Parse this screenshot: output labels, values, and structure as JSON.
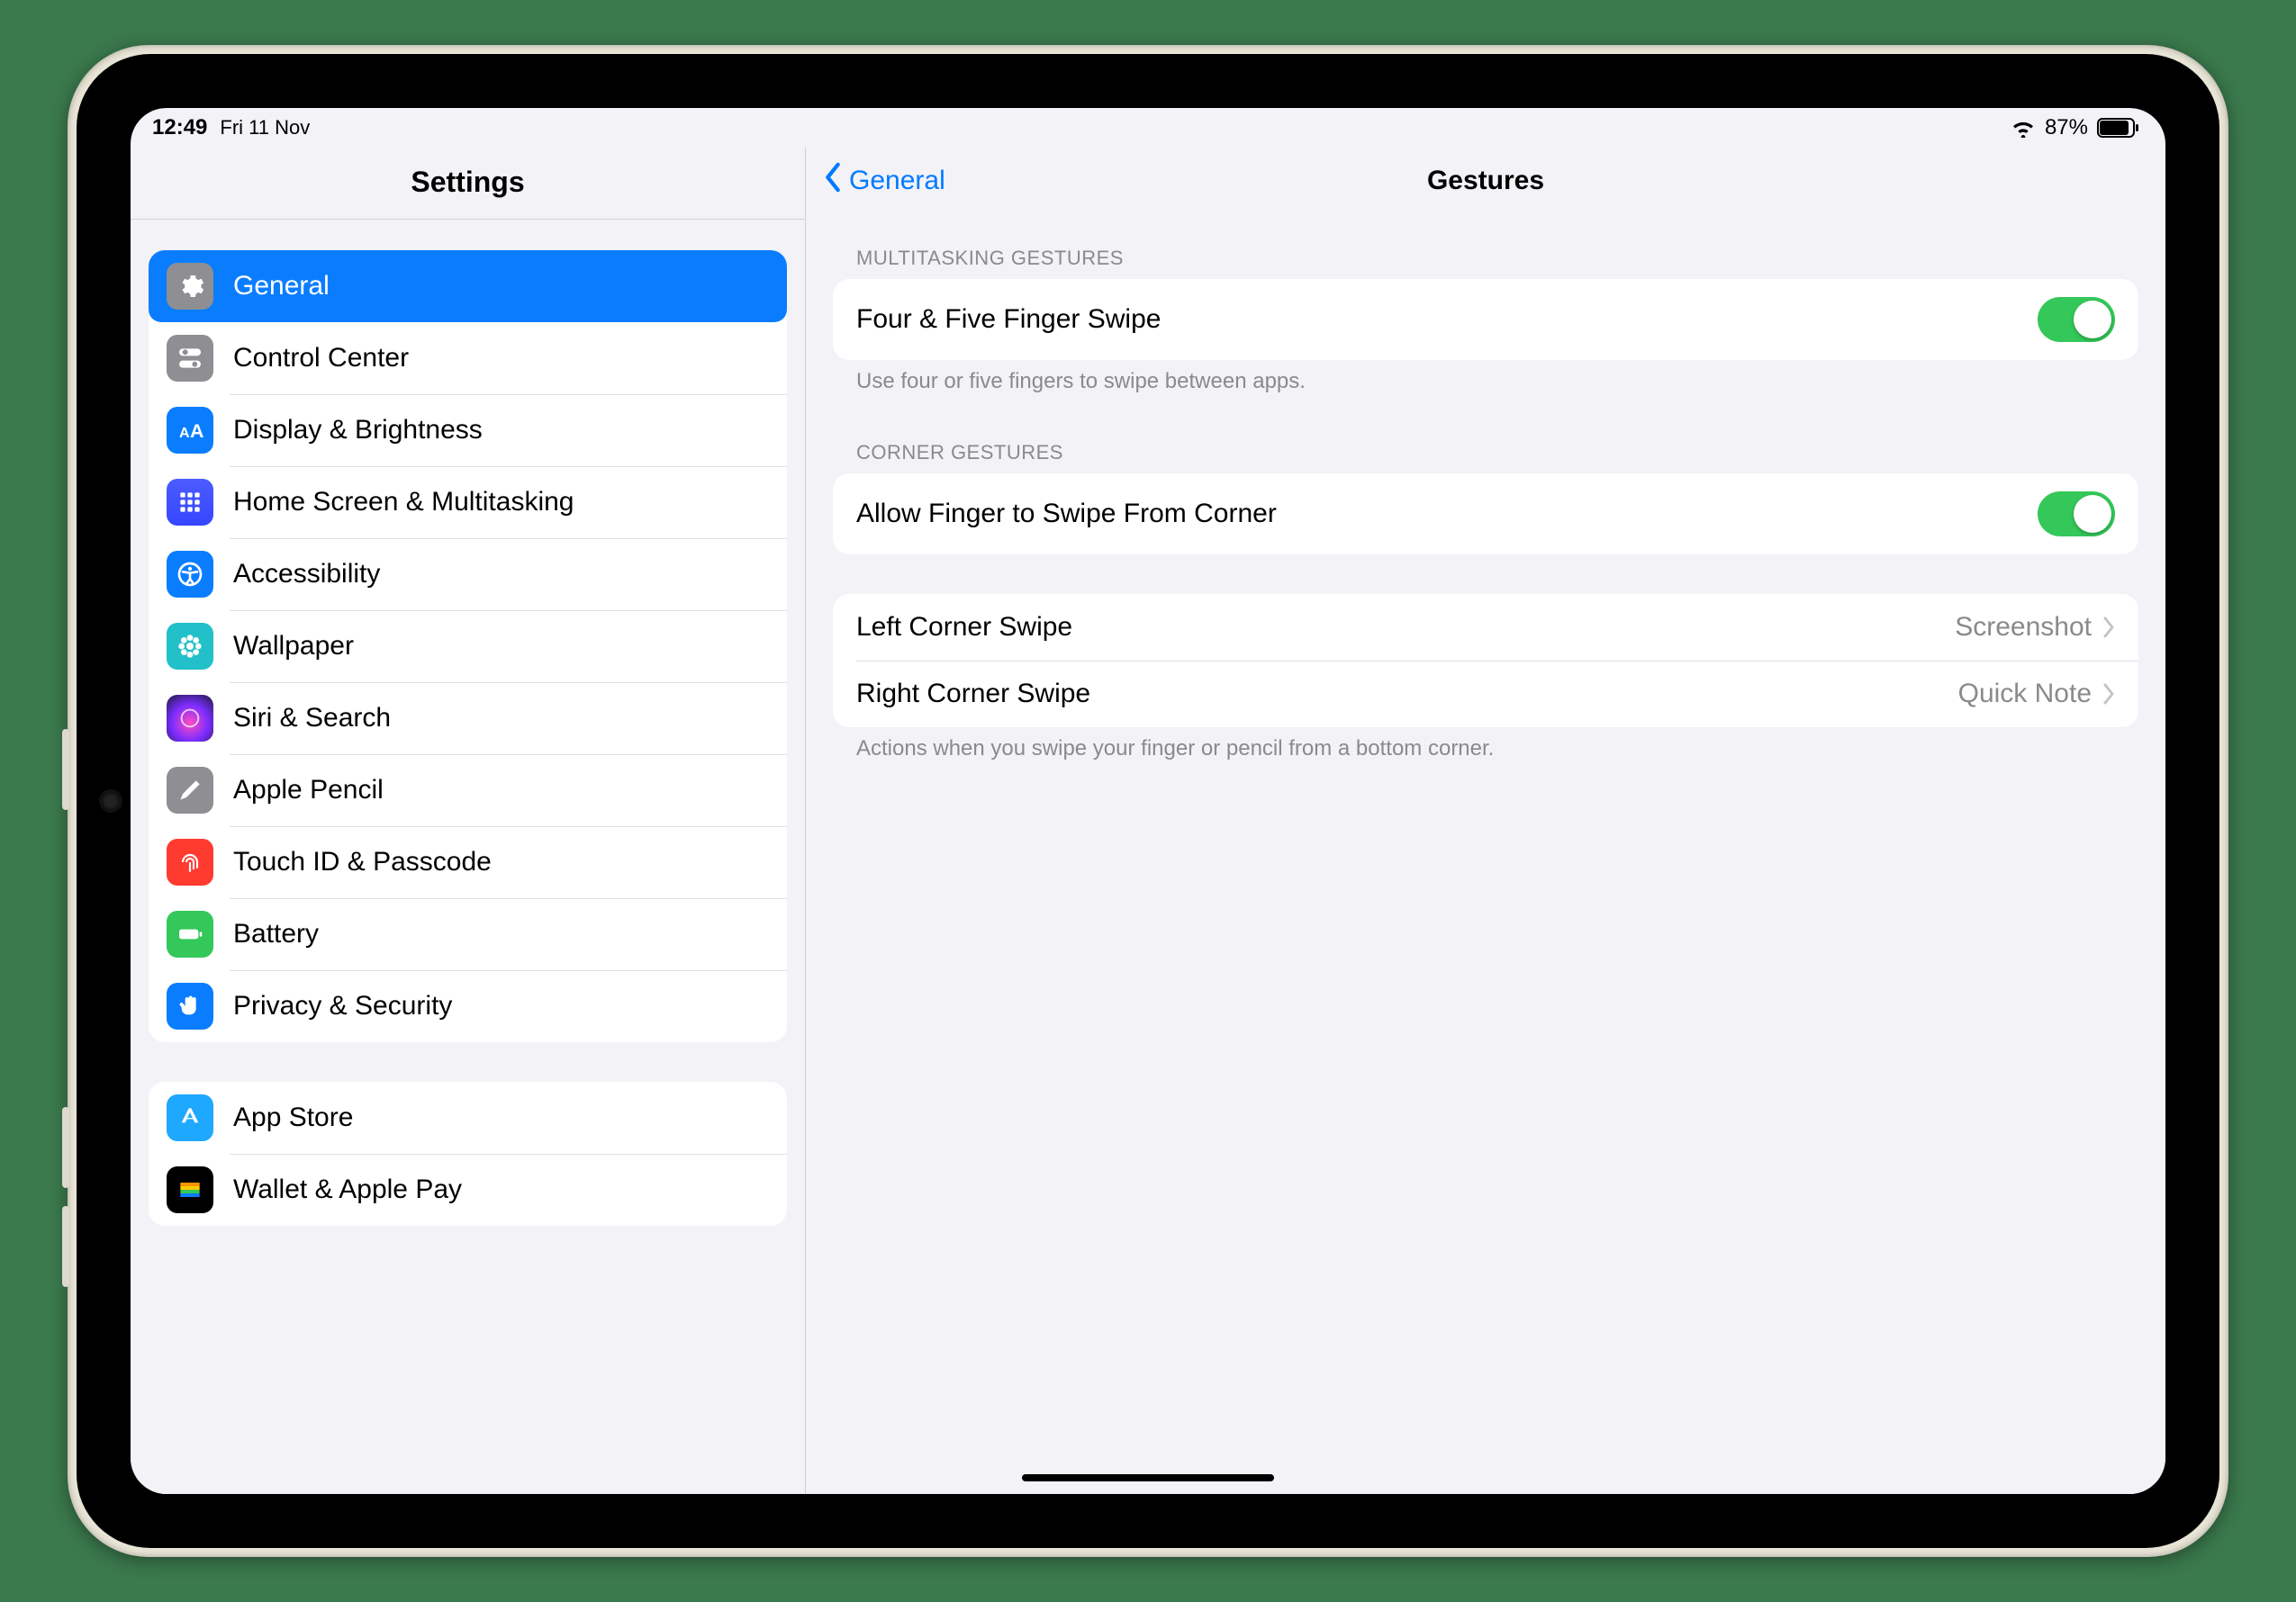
{
  "status": {
    "time": "12:49",
    "date": "Fri 11 Nov",
    "battery_pct": "87%"
  },
  "sidebar": {
    "title": "Settings",
    "groups": [
      {
        "items": [
          {
            "id": "general",
            "label": "General",
            "active": true
          },
          {
            "id": "control-center",
            "label": "Control Center",
            "active": false
          },
          {
            "id": "display",
            "label": "Display & Brightness",
            "active": false
          },
          {
            "id": "home-multi",
            "label": "Home Screen & Multitasking",
            "active": false
          },
          {
            "id": "accessibility",
            "label": "Accessibility",
            "active": false
          },
          {
            "id": "wallpaper",
            "label": "Wallpaper",
            "active": false
          },
          {
            "id": "siri",
            "label": "Siri & Search",
            "active": false
          },
          {
            "id": "apple-pencil",
            "label": "Apple Pencil",
            "active": false
          },
          {
            "id": "touchid",
            "label": "Touch ID & Passcode",
            "active": false
          },
          {
            "id": "battery",
            "label": "Battery",
            "active": false
          },
          {
            "id": "privacy",
            "label": "Privacy & Security",
            "active": false
          }
        ]
      },
      {
        "items": [
          {
            "id": "app-store",
            "label": "App Store",
            "active": false
          },
          {
            "id": "wallet",
            "label": "Wallet & Apple Pay",
            "active": false
          }
        ]
      }
    ]
  },
  "detail": {
    "back_label": "General",
    "title": "Gestures",
    "sections": {
      "multitasking": {
        "header": "MULTITASKING GESTURES",
        "toggle_label": "Four & Five Finger Swipe",
        "toggle_on": true,
        "footer": "Use four or five fingers to swipe between apps."
      },
      "corner": {
        "header": "CORNER GESTURES",
        "toggle_label": "Allow Finger to Swipe From Corner",
        "toggle_on": true
      },
      "actions": {
        "left_label": "Left Corner Swipe",
        "left_value": "Screenshot",
        "right_label": "Right Corner Swipe",
        "right_value": "Quick Note",
        "footer": "Actions when you swipe your finger or pencil from a bottom corner."
      }
    }
  }
}
